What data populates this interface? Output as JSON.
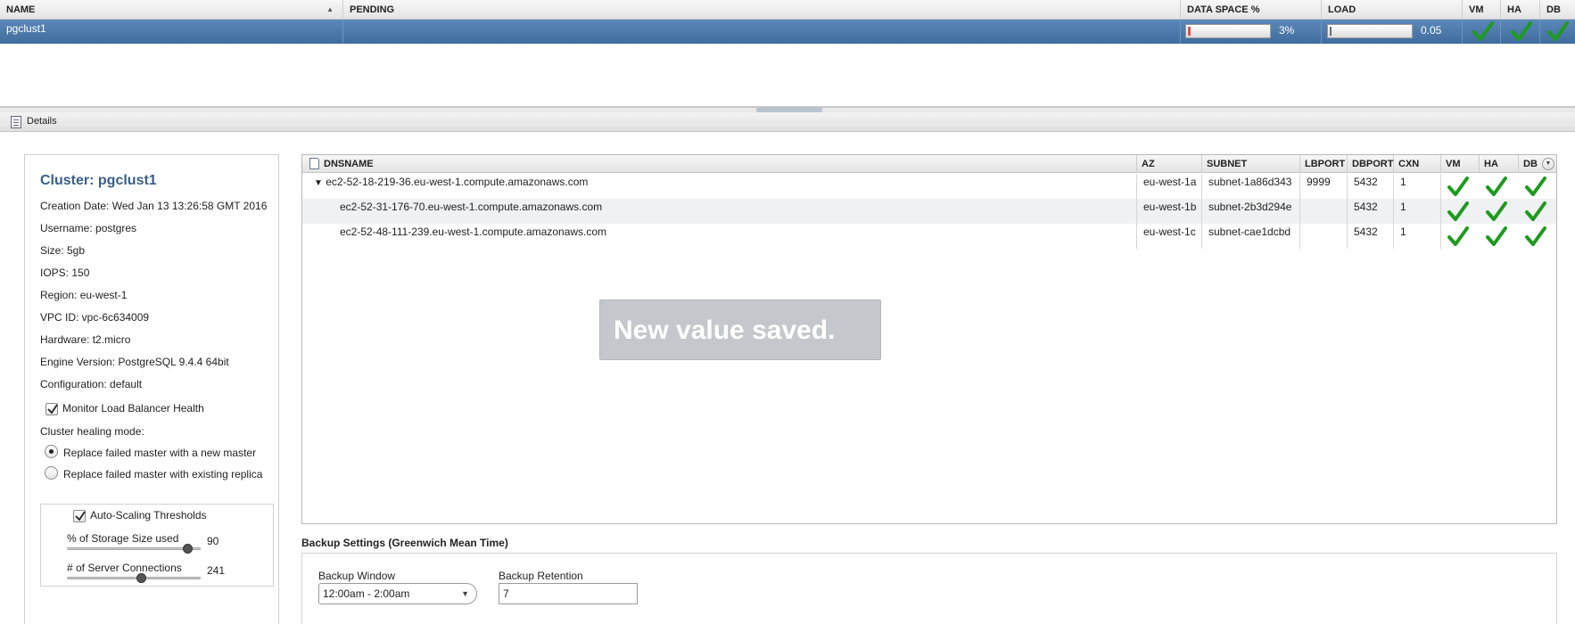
{
  "top_grid": {
    "columns": {
      "name": "NAME",
      "pending": "PENDING",
      "data_space": "DATA SPACE %",
      "load": "LOAD",
      "vm": "VM",
      "ha": "HA",
      "db": "DB"
    },
    "sort_indicator": "▲",
    "row": {
      "name": "pgclust1",
      "pending": "",
      "data_space_text": "3%",
      "data_space_fraction": 0.03,
      "load_text": "0.05",
      "load_fraction": 0.0,
      "vm_status": "ok",
      "ha_status": "ok",
      "db_status": "ok"
    }
  },
  "details_tab": {
    "label": "Details"
  },
  "cluster_info": {
    "title": "Cluster: pgclust1",
    "creation_date": "Creation Date: Wed Jan 13 13:26:58 GMT 2016",
    "username": "Username: postgres",
    "size": "Size: 5gb",
    "iops": "IOPS: 150",
    "region": "Region: eu-west-1",
    "vpc_id": "VPC ID: vpc-6c634009",
    "hardware": "Hardware: t2.micro",
    "engine_version": "Engine Version: PostgreSQL 9.4.4 64bit",
    "configuration": "Configuration: default",
    "monitor_lb_label": "Monitor Load Balancer Health",
    "monitor_lb_checked": true,
    "healing_mode_label": "Cluster healing mode:",
    "healing_options": [
      {
        "label": "Replace failed master with a new master",
        "selected": true
      },
      {
        "label": "Replace failed master with existing replica",
        "selected": false
      }
    ],
    "autoscaling": {
      "label": "Auto-Scaling Thresholds",
      "checked": true,
      "storage_label": "% of Storage Size used",
      "storage_value": "90",
      "storage_fraction": 0.9,
      "connections_label": "# of Server Connections",
      "connections_value": "241",
      "connections_fraction": 0.55
    }
  },
  "node_table": {
    "columns": {
      "dnsname": "DNSNAME",
      "az": "AZ",
      "subnet": "SUBNET",
      "lbport": "LBPORT",
      "dbport": "DBPORT",
      "cxn": "CXN",
      "vm": "VM",
      "ha": "HA",
      "db": "DB"
    },
    "expand_glyph": "▼",
    "rows": [
      {
        "dnsname": "ec2-52-18-219-36.eu-west-1.compute.amazonaws.com",
        "az": "eu-west-1a",
        "subnet": "subnet-1a86d343",
        "lbport": "9999",
        "dbport": "5432",
        "cxn": "1"
      },
      {
        "dnsname": "ec2-52-31-176-70.eu-west-1.compute.amazonaws.com",
        "az": "eu-west-1b",
        "subnet": "subnet-2b3d294e",
        "lbport": "",
        "dbport": "5432",
        "cxn": "1"
      },
      {
        "dnsname": "ec2-52-48-111-239.eu-west-1.compute.amazonaws.com",
        "az": "eu-west-1c",
        "subnet": "subnet-cae1dcbd",
        "lbport": "",
        "dbport": "5432",
        "cxn": "1"
      }
    ]
  },
  "toast": {
    "message": "New value saved."
  },
  "backup": {
    "title": "Backup Settings (Greenwich Mean Time)",
    "window_label": "Backup Window",
    "window_value": "12:00am - 2:00am",
    "retention_label": "Backup Retention",
    "retention_value": "7"
  },
  "colors": {
    "selection": "#4a78aa",
    "check_green": "#1e9a1e",
    "title_blue": "#3a5f86",
    "toast_bg": "#c4c7cb"
  }
}
